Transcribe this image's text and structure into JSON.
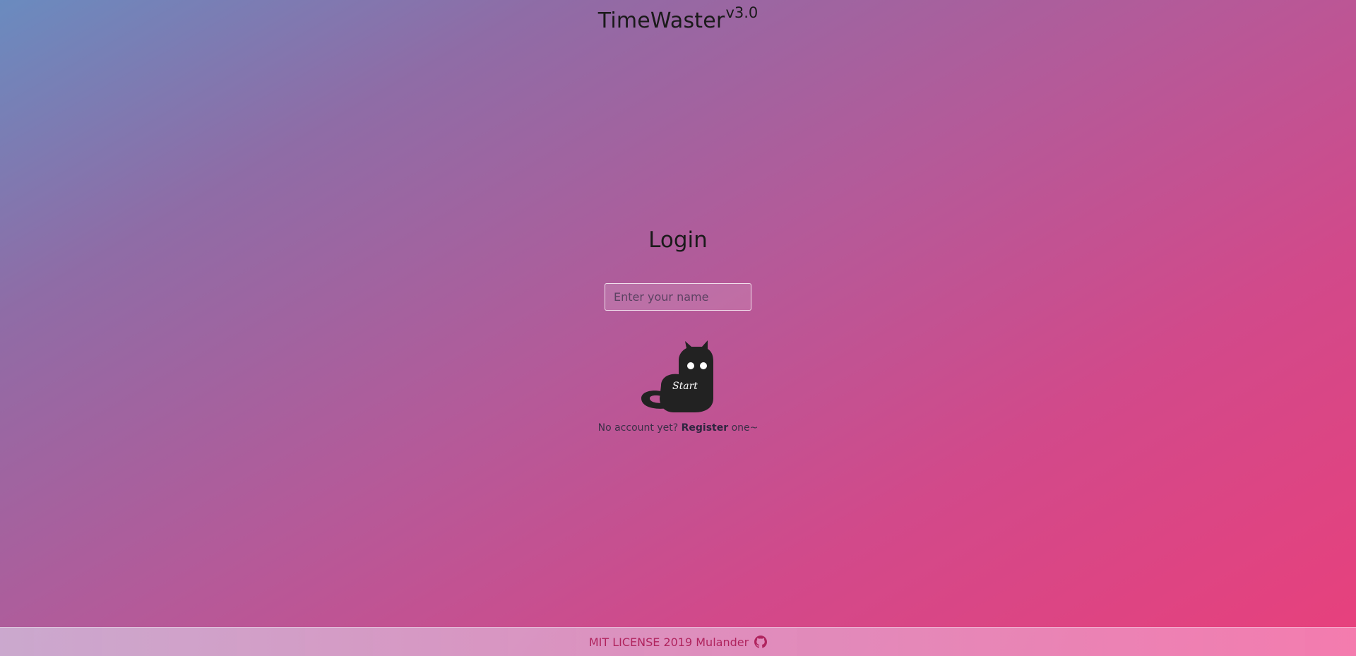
{
  "header": {
    "title": "TimeWaster",
    "version": "v3.0"
  },
  "login": {
    "heading": "Login",
    "name_placeholder": "Enter your name",
    "name_value": "",
    "start_label": "Start",
    "start_icon": "cat-icon"
  },
  "register": {
    "prefix": "No account yet?",
    "link_label": "Register",
    "suffix": "one~"
  },
  "footer": {
    "text": "MIT LICENSE 2019 Mulander",
    "icon": "github-icon"
  },
  "colors": {
    "gradient_start": "#6a8bbf",
    "gradient_end": "#e8407c",
    "footer_text": "#b0245e",
    "cat": "#222222"
  }
}
